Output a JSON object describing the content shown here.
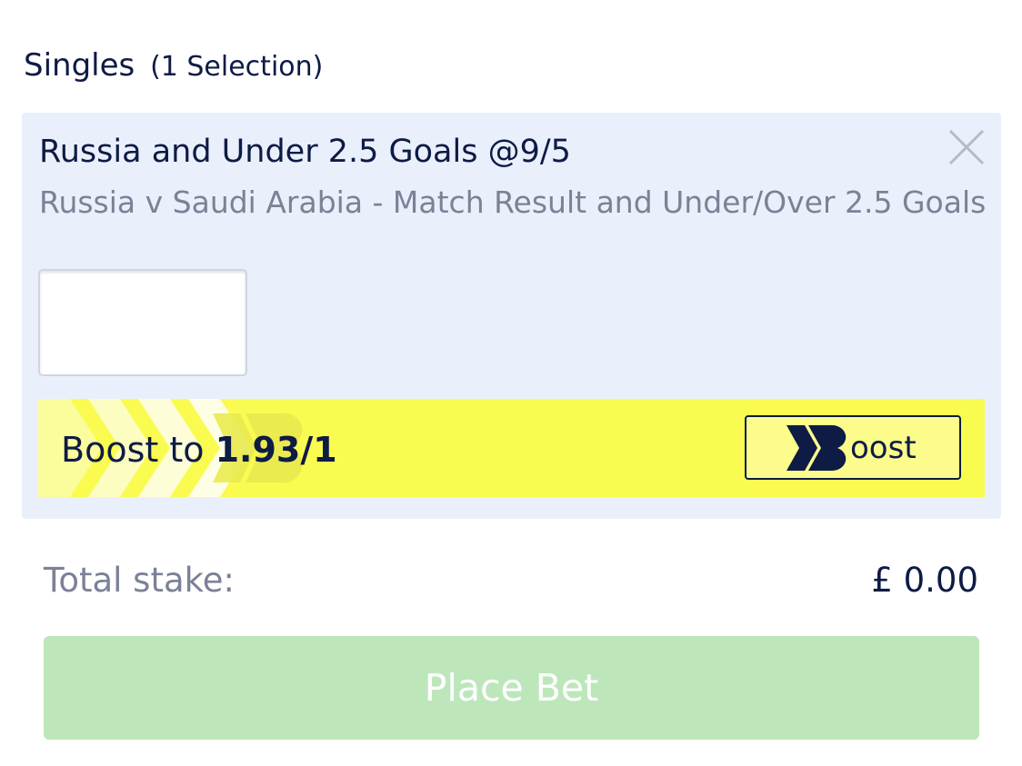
{
  "section": {
    "title": "Singles",
    "count_label": "(1 Selection)"
  },
  "selection": {
    "title": "Russia and Under 2.5 Goals @9/5",
    "market": "Russia v Saudi Arabia - Match Result and Under/Over 2.5 Goals",
    "close_icon": "close-icon",
    "stake_value": ""
  },
  "boost": {
    "prefix": "Boost to",
    "odds": "1.93/1",
    "button_label": "oost",
    "logo_letter": "B",
    "bar_color": "#fafb50"
  },
  "totals": {
    "label": "Total stake:",
    "value": "£ 0.00"
  },
  "actions": {
    "place_bet": "Place Bet",
    "place_bet_color": "#bde7bb"
  }
}
